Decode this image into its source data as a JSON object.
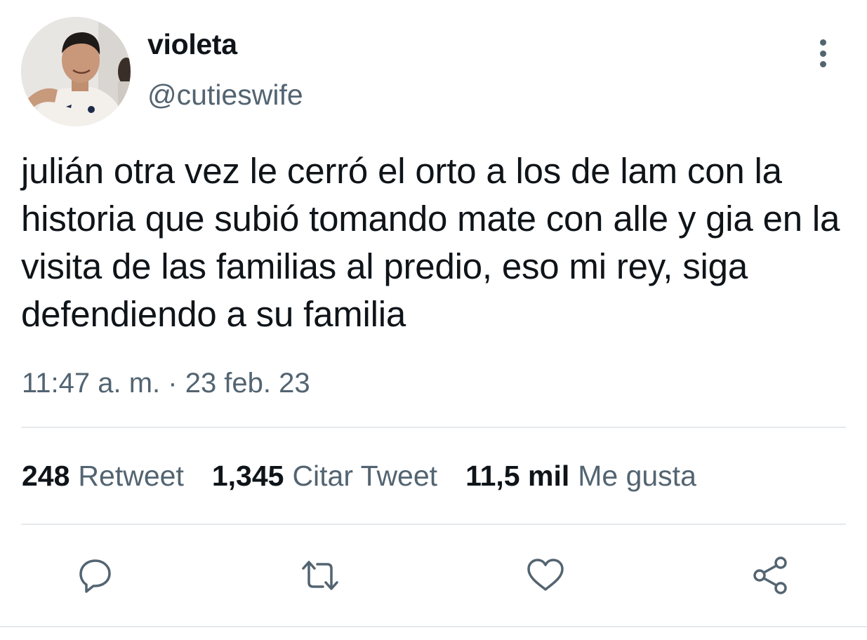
{
  "tweet": {
    "author": {
      "display_name": "violeta",
      "handle": "@cutieswife",
      "avatar_icon": "profile-photo"
    },
    "text": "julián otra vez le cerró el orto a los de lam con la historia que subió tomando mate con alle y gia en la visita de las familias al predio, eso mi rey, siga defendiendo a su familia",
    "timestamp": "11:47 a. m. · 23 feb. 23",
    "stats": {
      "retweets": {
        "count": "248",
        "label": "Retweet"
      },
      "quotes": {
        "count": "1,345",
        "label": "Citar Tweet"
      },
      "likes": {
        "count": "11,5 mil",
        "label": "Me gusta"
      }
    },
    "actions": [
      "reply-icon",
      "retweet-icon",
      "like-icon",
      "share-icon"
    ],
    "colors": {
      "primary_text": "#0f1419",
      "secondary_text": "#536471",
      "divider": "#e6e9ec"
    }
  }
}
